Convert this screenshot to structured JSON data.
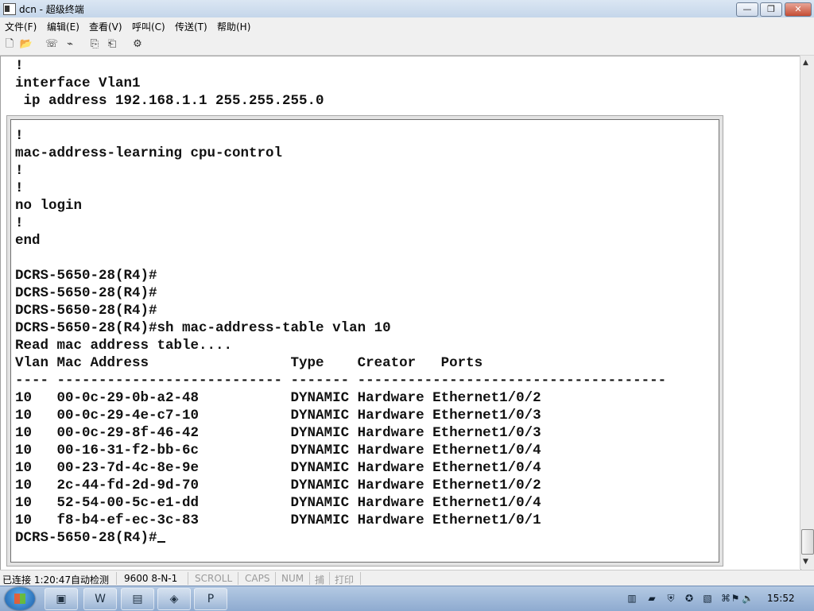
{
  "window": {
    "title": "dcn - 超级终端",
    "buttons": {
      "minimize": "—",
      "maximize": "❐",
      "close": "✕"
    }
  },
  "menu": [
    "文件(F)",
    "编辑(E)",
    "查看(V)",
    "呼叫(C)",
    "传送(T)",
    "帮助(H)"
  ],
  "toolbar": [
    {
      "name": "new-icon",
      "glyph": "🗋"
    },
    {
      "name": "open-icon",
      "glyph": "📂"
    },
    {
      "name": "call-icon",
      "glyph": "☏"
    },
    {
      "name": "disconnect-icon",
      "glyph": "⌁"
    },
    {
      "name": "send-icon",
      "glyph": "⎘"
    },
    {
      "name": "receive-icon",
      "glyph": "⎗"
    },
    {
      "name": "properties-icon",
      "glyph": "⚙"
    }
  ],
  "terminal": {
    "background_lines": [
      "!",
      "interface Vlan1",
      " ip address 192.168.1.1 255.255.255.0"
    ],
    "panel_lines": [
      "!",
      "mac-address-learning cpu-control",
      "!",
      "!",
      "no login",
      "!",
      "end",
      "",
      "DCRS-5650-28(R4)#",
      "DCRS-5650-28(R4)#",
      "DCRS-5650-28(R4)#",
      "DCRS-5650-28(R4)#sh mac-address-table vlan 10",
      "Read mac address table....",
      "Vlan Mac Address                 Type    Creator   Ports",
      "---- --------------------------- ------- -------------------------------------",
      "10   00-0c-29-0b-a2-48           DYNAMIC Hardware Ethernet1/0/2",
      "10   00-0c-29-4e-c7-10           DYNAMIC Hardware Ethernet1/0/3",
      "10   00-0c-29-8f-46-42           DYNAMIC Hardware Ethernet1/0/3",
      "10   00-16-31-f2-bb-6c           DYNAMIC Hardware Ethernet1/0/4",
      "10   00-23-7d-4c-8e-9e           DYNAMIC Hardware Ethernet1/0/4",
      "10   2c-44-fd-2d-9d-70           DYNAMIC Hardware Ethernet1/0/2",
      "10   52-54-00-5c-e1-dd           DYNAMIC Hardware Ethernet1/0/4",
      "10   f8-b4-ef-ec-3c-83           DYNAMIC Hardware Ethernet1/0/1"
    ],
    "prompt": "DCRS-5650-28(R4)#"
  },
  "status": {
    "connection": "已连接 1:20:47",
    "detect": "自动检测",
    "baud": "9600 8-N-1",
    "scroll": "SCROLL",
    "caps": "CAPS",
    "num": "NUM",
    "capture": "捕",
    "print": "打印"
  },
  "taskbar": {
    "apps": [
      {
        "name": "explorer-task-icon",
        "glyph": "▣"
      },
      {
        "name": "word-task-icon",
        "glyph": "W"
      },
      {
        "name": "folder-task-icon",
        "glyph": "▤"
      },
      {
        "name": "network-task-icon",
        "glyph": "◈"
      },
      {
        "name": "powerpoint-task-icon",
        "glyph": "P"
      }
    ],
    "tray": [
      {
        "name": "keyboard-tray-icon",
        "glyph": "▥"
      },
      {
        "name": "network-tray-icon",
        "glyph": "▰"
      },
      {
        "name": "shield-tray-icon",
        "glyph": "⛨"
      },
      {
        "name": "security-tray-icon",
        "glyph": "✪"
      },
      {
        "name": "device-tray-icon",
        "glyph": "▧"
      },
      {
        "name": "usb-tray-icon",
        "glyph": "⌘"
      },
      {
        "name": "flag-tray-icon",
        "glyph": "⚑"
      },
      {
        "name": "volume-tray-icon",
        "glyph": "🔈"
      }
    ],
    "clock": "15:52"
  }
}
